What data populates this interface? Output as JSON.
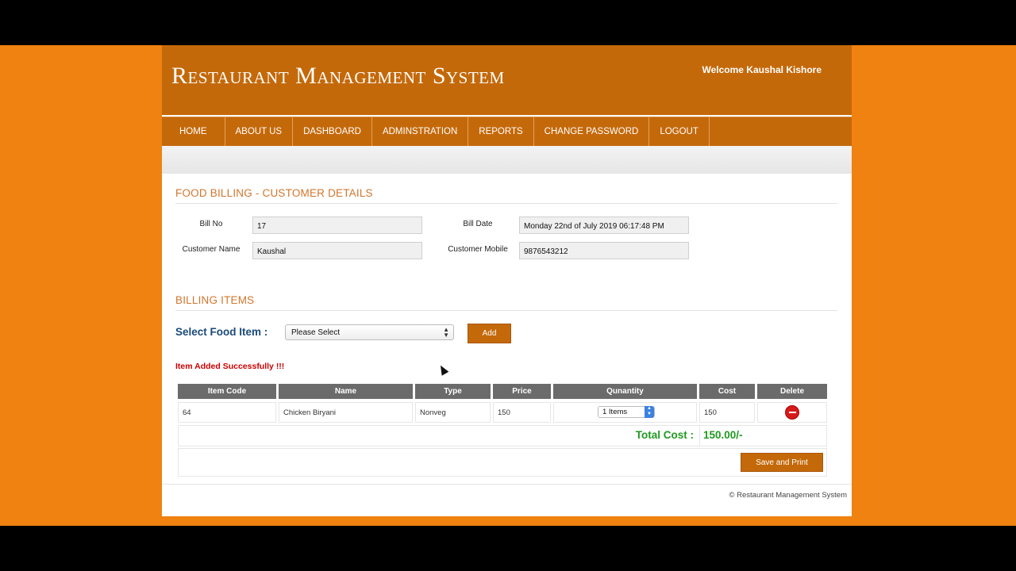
{
  "header": {
    "title": "Restaurant Management System",
    "welcome": "Welcome Kaushal Kishore"
  },
  "nav": [
    {
      "label": "HOME"
    },
    {
      "label": "ABOUT US"
    },
    {
      "label": "DASHBOARD"
    },
    {
      "label": "ADMINSTRATION"
    },
    {
      "label": "REPORTS"
    },
    {
      "label": "CHANGE PASSWORD"
    },
    {
      "label": "LOGOUT"
    }
  ],
  "customer": {
    "section_title": "FOOD BILLING - CUSTOMER DETAILS",
    "bill_no_label": "Bill No",
    "bill_no": "17",
    "bill_date_label": "Bill Date",
    "bill_date": "Monday 22nd of July 2019 06:17:48 PM",
    "customer_name_label": "Customer Name",
    "customer_name": "Kaushal",
    "customer_mobile_label": "Customer Mobile",
    "customer_mobile": "9876543212"
  },
  "billing": {
    "section_title": "BILLING ITEMS",
    "select_label": "Select Food Item :",
    "select_value": "Please Select",
    "add_label": "Add",
    "message": "Item Added Successfully !!!",
    "columns": [
      "Item Code",
      "Name",
      "Type",
      "Price",
      "Qunantity",
      "Cost",
      "Delete"
    ],
    "rows": [
      {
        "item_code": "64",
        "name": "Chicken Biryani",
        "type": "Nonveg",
        "price": "150",
        "quantity": "1 Items",
        "cost": "150"
      }
    ],
    "total_label": "Total Cost :",
    "total_value": "150.00/-",
    "save_label": "Save and Print"
  },
  "footer": {
    "text": "© Restaurant Management System"
  },
  "colors": {
    "brand": "#c4690a",
    "background": "#ef8210",
    "section_title": "#d2762c",
    "success": "#1f9a1f",
    "message": "#cc0000"
  }
}
